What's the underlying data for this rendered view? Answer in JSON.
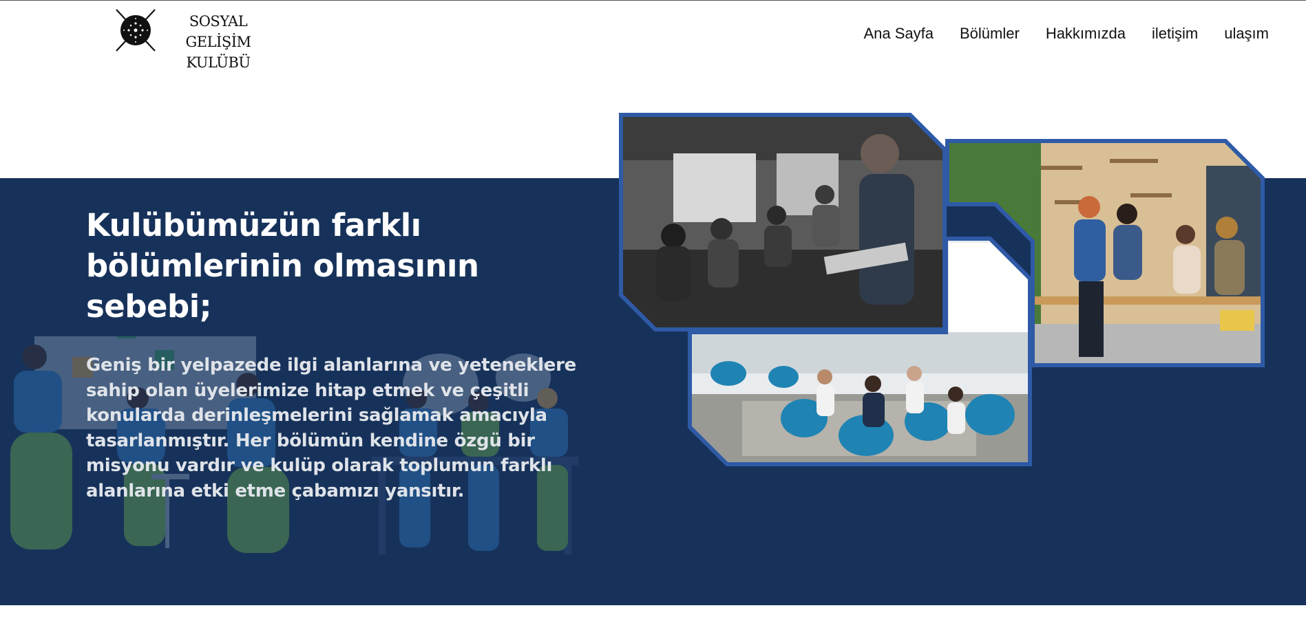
{
  "brand": {
    "logo_line1": "SOSYAL GELİŞİM",
    "logo_line2": "KULÜBÜ"
  },
  "nav": {
    "items": [
      {
        "label": "Ana Sayfa"
      },
      {
        "label": "Bölümler"
      },
      {
        "label": "Hakkımızda"
      },
      {
        "label": "iletişim"
      },
      {
        "label": "ulaşım"
      }
    ]
  },
  "hero": {
    "title": "Kulübümüzün farklı bölümlerinin olmasının sebebi;",
    "description": "Geniş bir yelpazede ilgi alanlarına ve yeteneklere sahip olan üyelerimize hitap etmek ve çeşitli konularda derinleşmelerini sağlamak amacıyla tasarlanmıştır. Her bölümün kendine özgü bir misyonu vardır ve kulüp olarak toplumun farklı alanlarına etki etme çabamızı yansıtır."
  },
  "photos": [
    {
      "icon": "meeting-presentation-photo"
    },
    {
      "icon": "team-office-photo"
    },
    {
      "icon": "lounge-meeting-photo"
    }
  ],
  "colors": {
    "band": "#17325a",
    "frame": "#2e5aa6",
    "heading": "#ffffff",
    "body_text": "#dfe3e9"
  }
}
